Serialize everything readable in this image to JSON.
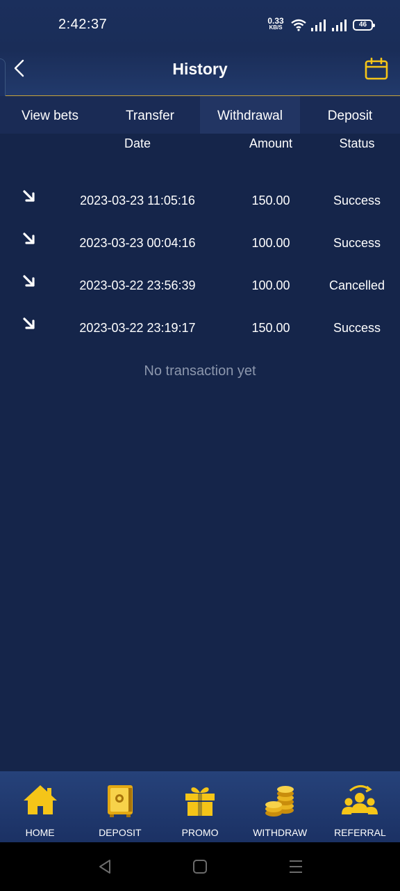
{
  "status_bar": {
    "time": "2:42:37",
    "net_speed_value": "0.33",
    "net_speed_unit": "KB/S",
    "battery": "46"
  },
  "header": {
    "title": "History"
  },
  "tabs": [
    {
      "label": "View bets",
      "active": false
    },
    {
      "label": "Transfer",
      "active": false
    },
    {
      "label": "Withdrawal",
      "active": true
    },
    {
      "label": "Deposit",
      "active": false
    }
  ],
  "table": {
    "columns": {
      "date": "Date",
      "amount": "Amount",
      "status": "Status"
    },
    "rows": [
      {
        "date": "2023-03-23 11:05:16",
        "amount": "150.00",
        "status": "Success"
      },
      {
        "date": "2023-03-23 00:04:16",
        "amount": "100.00",
        "status": "Success"
      },
      {
        "date": "2023-03-22 23:56:39",
        "amount": "100.00",
        "status": "Cancelled"
      },
      {
        "date": "2023-03-22 23:19:17",
        "amount": "150.00",
        "status": "Success"
      }
    ],
    "empty_message": "No transaction yet"
  },
  "bottom_nav": [
    {
      "label": "HOME",
      "icon": "home-icon"
    },
    {
      "label": "DEPOSIT",
      "icon": "safe-icon"
    },
    {
      "label": "PROMO",
      "icon": "gift-icon"
    },
    {
      "label": "WITHDRAW",
      "icon": "coins-icon"
    },
    {
      "label": "REFERRAL",
      "icon": "users-icon"
    }
  ],
  "colors": {
    "background": "#15254a",
    "accent": "#f5c518",
    "muted_text": "#8c97ad"
  }
}
